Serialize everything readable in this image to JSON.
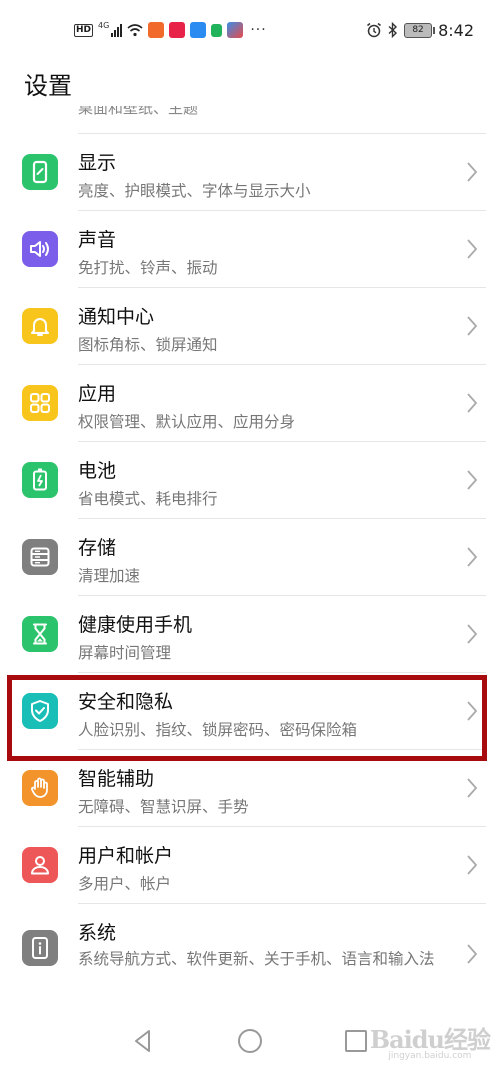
{
  "status_bar": {
    "hd_label": "HD",
    "signal_label": "4G",
    "battery_level": "82",
    "time": "8:42",
    "overflow": "···",
    "notification_icons": [
      "app-icon-orange",
      "app-icon-red",
      "app-icon-blue",
      "app-icon-green",
      "app-icon-multicolor"
    ]
  },
  "header": {
    "title": "设置"
  },
  "partial_item": {
    "subtitle": "桌面和壁纸、主题"
  },
  "items": [
    {
      "title": "显示",
      "subtitle": "亮度、护眼模式、字体与显示大小",
      "icon": "display-icon",
      "color": "#2bc36b"
    },
    {
      "title": "声音",
      "subtitle": "免打扰、铃声、振动",
      "icon": "sound-icon",
      "color": "#7b5ee9"
    },
    {
      "title": "通知中心",
      "subtitle": "图标角标、锁屏通知",
      "icon": "bell-icon",
      "color": "#f8c51c"
    },
    {
      "title": "应用",
      "subtitle": "权限管理、默认应用、应用分身",
      "icon": "apps-grid-icon",
      "color": "#f8c51c"
    },
    {
      "title": "电池",
      "subtitle": "省电模式、耗电排行",
      "icon": "battery-icon",
      "color": "#2bc36b"
    },
    {
      "title": "存储",
      "subtitle": "清理加速",
      "icon": "storage-icon",
      "color": "#7f7f7f"
    },
    {
      "title": "健康使用手机",
      "subtitle": "屏幕时间管理",
      "icon": "hourglass-icon",
      "color": "#2bc36b"
    },
    {
      "title": "安全和隐私",
      "subtitle": "人脸识别、指纹、锁屏密码、密码保险箱",
      "icon": "shield-icon",
      "color": "#19bfb7",
      "highlighted": true
    },
    {
      "title": "智能辅助",
      "subtitle": "无障碍、智慧识屏、手势",
      "icon": "hand-icon",
      "color": "#f2932b"
    },
    {
      "title": "用户和帐户",
      "subtitle": "多用户、帐户",
      "icon": "user-icon",
      "color": "#ee5757"
    },
    {
      "title": "系统",
      "subtitle": "系统导航方式、软件更新、关于手机、语言和输入法",
      "icon": "system-info-icon",
      "color": "#7f7f7f"
    }
  ],
  "highlight_color": "#a80b0d",
  "watermark": {
    "main": "Baidu经验",
    "sub": "jingyan.baidu.com"
  }
}
